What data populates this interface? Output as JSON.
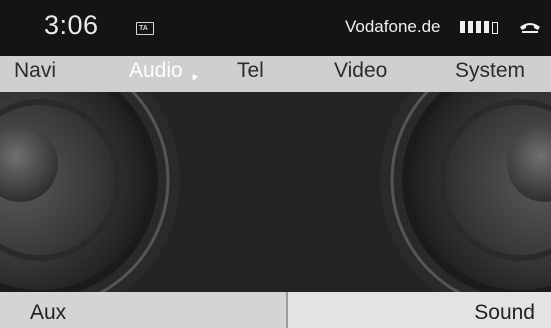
{
  "status": {
    "time": "3:06",
    "ta_label": "TA",
    "operator": "Vodafone.de",
    "signal_icon": "signal-strength-icon",
    "phone_icon": "phone-hangup-icon"
  },
  "nav": {
    "tabs": [
      {
        "label": "Navi"
      },
      {
        "label": "Audio"
      },
      {
        "label": "Tel"
      },
      {
        "label": "Video"
      },
      {
        "label": "System"
      }
    ],
    "active": "Audio"
  },
  "content": {
    "image": "speaker-graphic"
  },
  "bottom": {
    "left_label": "Aux",
    "right_label": "Sound"
  },
  "colors": {
    "statusbar": "#141414",
    "navbar": "#cfcfcf",
    "active_tab": "#ffffff",
    "content_bg": "#242424"
  }
}
